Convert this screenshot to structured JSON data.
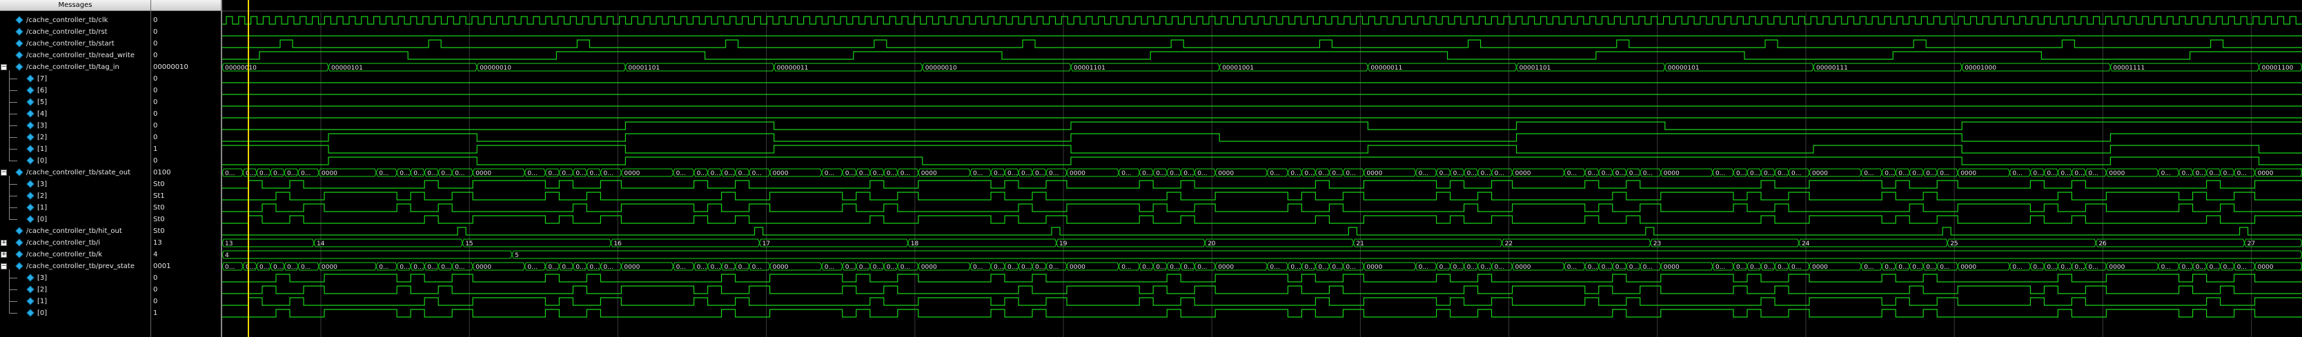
{
  "header": {
    "messages_label": "Messages"
  },
  "signals": [
    {
      "name": "/cache_controller_tb/clk",
      "value": "0",
      "expander": ""
    },
    {
      "name": "/cache_controller_tb/rst",
      "value": "0",
      "expander": ""
    },
    {
      "name": "/cache_controller_tb/start",
      "value": "0",
      "expander": ""
    },
    {
      "name": "/cache_controller_tb/read_write",
      "value": "0",
      "expander": ""
    },
    {
      "name": "/cache_controller_tb/tag_in",
      "value": "00000010",
      "expander": "−"
    },
    {
      "name": "[7]",
      "value": "0",
      "expander": ""
    },
    {
      "name": "[6]",
      "value": "0",
      "expander": ""
    },
    {
      "name": "[5]",
      "value": "0",
      "expander": ""
    },
    {
      "name": "[4]",
      "value": "0",
      "expander": ""
    },
    {
      "name": "[3]",
      "value": "0",
      "expander": ""
    },
    {
      "name": "[2]",
      "value": "0",
      "expander": ""
    },
    {
      "name": "[1]",
      "value": "1",
      "expander": ""
    },
    {
      "name": "[0]",
      "value": "0",
      "expander": ""
    },
    {
      "name": "/cache_controller_tb/state_out",
      "value": "0100",
      "expander": "−"
    },
    {
      "name": "[3]",
      "value": "St0",
      "expander": ""
    },
    {
      "name": "[2]",
      "value": "St1",
      "expander": ""
    },
    {
      "name": "[1]",
      "value": "St0",
      "expander": ""
    },
    {
      "name": "[0]",
      "value": "St0",
      "expander": ""
    },
    {
      "name": "/cache_controller_tb/hit_out",
      "value": "St0",
      "expander": ""
    },
    {
      "name": "/cache_controller_tb/i",
      "value": "13",
      "expander": "+"
    },
    {
      "name": "/cache_controller_tb/k",
      "value": "4",
      "expander": "+"
    },
    {
      "name": "/cache_controller_tb/prev_state",
      "value": "0001",
      "expander": "−"
    },
    {
      "name": "[3]",
      "value": "0",
      "expander": ""
    },
    {
      "name": "[2]",
      "value": "0",
      "expander": ""
    },
    {
      "name": "[1]",
      "value": "0",
      "expander": ""
    },
    {
      "name": "[0]",
      "value": "1",
      "expander": ""
    }
  ],
  "bus_labels": {
    "tag_in": [
      "00000010",
      "00000101",
      "00000010",
      "00001101",
      "00000011",
      "00000010",
      "00001101",
      "00001001",
      "00000011",
      "00001101",
      "00000101",
      "00000111",
      "00001000",
      "00001111",
      "00001100"
    ],
    "state_out": [
      "0000",
      "0000",
      "0000",
      "0000",
      "0000",
      "0000",
      "0000",
      "0000",
      "0000",
      "0000",
      "0000",
      "0000",
      "0000",
      "0000",
      "0000"
    ],
    "i": [
      "13",
      "14",
      "15",
      "16",
      "17",
      "18",
      "19",
      "20",
      "21",
      "22",
      "23",
      "24",
      "25",
      "26",
      "27"
    ],
    "k": [
      "4",
      "5"
    ],
    "prev_state": [
      "0000",
      "0000",
      "0000",
      "0000",
      "0000",
      "0000",
      "0000",
      "0000",
      "0000",
      "0000",
      "0000",
      "0000",
      "0000",
      "0000",
      "0000"
    ],
    "short_abbrev": "0..."
  },
  "colors": {
    "wave": "#18d418",
    "cursor": "#ffd800",
    "grid": "#3a3a3a",
    "text": "#e6e6e6",
    "icon": "#27aee8"
  }
}
